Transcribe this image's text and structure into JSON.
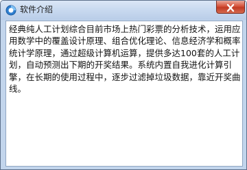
{
  "window": {
    "title": "软件介绍",
    "icon": "app-logo-icon",
    "close_icon": "close-icon",
    "colors": {
      "frame": "#c2d5ec",
      "close_button": "#d5533b",
      "content_bg": "#ffffff",
      "text": "#111111"
    }
  },
  "content": {
    "text": "经典纯人工计划综合目前市场上热门彩票的分析技术，运用应用数学中的覆盖设计原理、组合优化理论、信息经济学和概率统计学原理，通过超级计算机运算，提供多达100套的人工计划，自动预测出下期的开奖结果。系统内置自我进化计算引擎，在长期的使用过程中，逐步过滤掉垃圾数据，靠近开奖曲线。"
  }
}
